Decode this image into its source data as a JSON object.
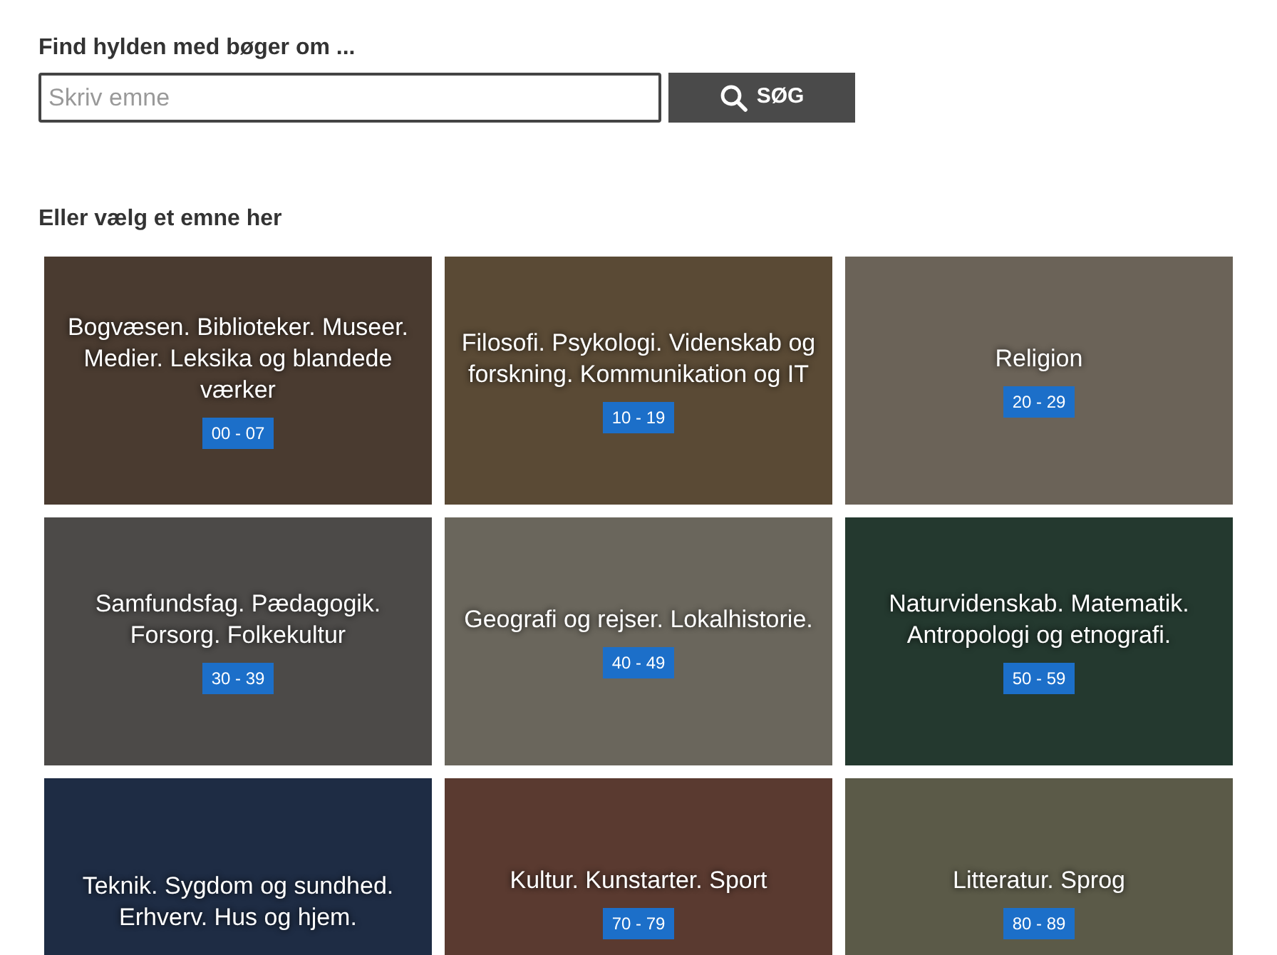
{
  "search": {
    "label": "Find hylden med bøger om ...",
    "placeholder": "Skriv emne",
    "button": "SØG"
  },
  "browse_heading": "Eller vælg et emne her",
  "categories": [
    {
      "title": "Bogvæsen. Biblioteker. Museer. Medier. Leksika og blandede værker",
      "range": "00 - 07"
    },
    {
      "title": "Filosofi. Psykologi. Videnskab og forskning. Kommunikation og IT",
      "range": "10 - 19"
    },
    {
      "title": "Religion",
      "range": "20 - 29"
    },
    {
      "title": "Samfundsfag. Pædagogik. Forsorg. Folkekultur",
      "range": "30 - 39"
    },
    {
      "title": "Geografi og rejser. Lokalhistorie.",
      "range": "40 - 49"
    },
    {
      "title": "Naturvidenskab. Matematik. Antropologi og etnografi.",
      "range": "50 - 59"
    },
    {
      "title": "Teknik. Sygdom og sundhed. Erhverv. Hus og hjem."
    },
    {
      "title": "Kultur. Kunstarter. Sport",
      "range": "70 - 79"
    },
    {
      "title": "Litteratur. Sprog",
      "range": "80 - 89"
    }
  ]
}
